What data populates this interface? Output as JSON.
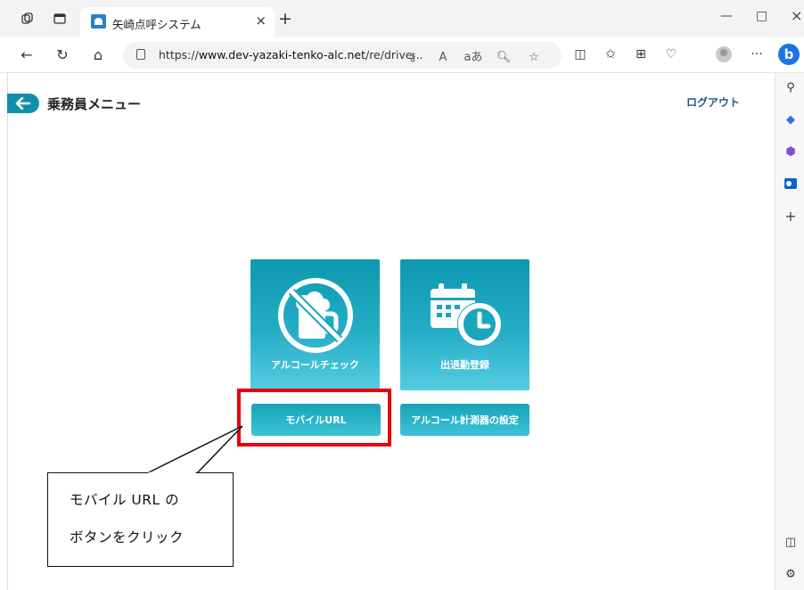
{
  "browser": {
    "tab_title": "矢崎点呼システム",
    "tab_close": "×",
    "new_tab": "+",
    "url_prefix": "https://",
    "url_host": "www.dev-yazaki-tenko-alc.net",
    "url_path": "/re/drive...",
    "read_aloud": "A",
    "translate": "aあ",
    "more": "···",
    "copilot": "b",
    "minimize": "—",
    "maximize": "□",
    "close": "×"
  },
  "header": {
    "title": "乗務員メニュー",
    "back_glyph": "🡐",
    "logout": "ログアウト"
  },
  "tiles": [
    {
      "label": "アルコールチェック",
      "icon": "no-drinking-icon"
    },
    {
      "label": "出退勤登録",
      "icon": "calendar-clock-icon"
    }
  ],
  "buttons": {
    "mobile_url": "モバイルURL",
    "alcohol_meter_settings": "アルコール計測器の設定"
  },
  "annotation": {
    "line1": "モバイル URL の",
    "line2": "ボタンをクリック",
    "highlight_color": "#e8000b"
  },
  "colors": {
    "accent": "#1090a8",
    "tile_top": "#0e98af",
    "tile_bottom": "#55cce0"
  }
}
